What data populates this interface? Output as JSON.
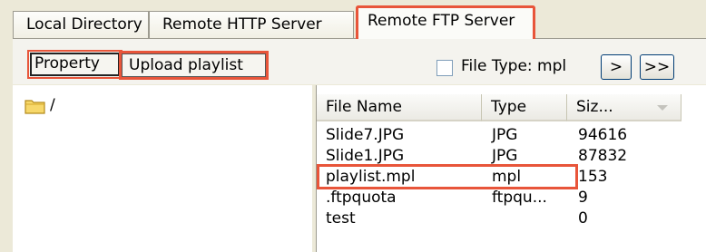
{
  "tabs": [
    {
      "label": "Local Directory"
    },
    {
      "label": "Remote HTTP Server"
    },
    {
      "label": "Remote FTP Server"
    }
  ],
  "toolbar": {
    "property_label": "Property",
    "upload_label": "Upload playlist",
    "file_type_label": "File Type: mpl",
    "file_type_checked": false,
    "next_label": ">",
    "last_label": ">>"
  },
  "tree": {
    "root_label": "/"
  },
  "list": {
    "columns": [
      "File Name",
      "Type",
      "Siz..."
    ],
    "rows": [
      {
        "name": "Slide7.JPG",
        "type": "JPG",
        "size": "94616"
      },
      {
        "name": "Slide1.JPG",
        "type": "JPG",
        "size": "87832"
      },
      {
        "name": "playlist.mpl",
        "type": "mpl",
        "size": "153"
      },
      {
        "name": ".ftpquota",
        "type": "ftpqu...",
        "size": "9"
      },
      {
        "name": "test",
        "type": "",
        "size": "0"
      }
    ]
  },
  "colors": {
    "highlight": "#e8553a",
    "window_bg": "#ece9d8"
  },
  "icons": {
    "folder": "folder-icon",
    "sort": "sort-arrow-icon"
  }
}
